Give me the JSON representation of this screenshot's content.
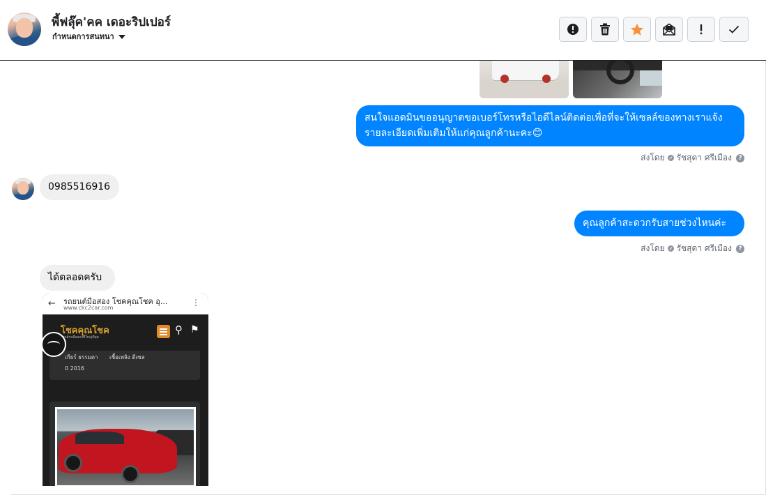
{
  "header": {
    "contact_name": "พี้ฟลุ๊ค'คค เดอะริปเปอร์",
    "conversation_settings": "กำหนดการสนทนา",
    "actions": [
      {
        "name": "mark-spam-button",
        "icon": "alert-circle-icon"
      },
      {
        "name": "delete-button",
        "icon": "trash-icon"
      },
      {
        "name": "star-button",
        "icon": "star-icon",
        "color": "#f7923a"
      },
      {
        "name": "mark-unread-button",
        "icon": "envelope-icon"
      },
      {
        "name": "follow-up-button",
        "icon": "exclamation-icon"
      },
      {
        "name": "mark-done-button",
        "icon": "check-icon"
      }
    ]
  },
  "messages": [
    {
      "direction": "outgoing",
      "text": "สนใจแอดมินขออนุญาตขอเบอร์โทรหรือไอดีไลน์ติดต่อเพื่อที่จะให้เซลล์ของทางเราแจ้งรายละเอียดเพิ่มเติมให้แก่คุณลูกค้านะคะ😊",
      "sent_by_label": "ส่งโดย",
      "sender": "รัชสุดา ศรีเมือง"
    },
    {
      "direction": "incoming",
      "text": "0985516916"
    },
    {
      "direction": "outgoing",
      "text": "คุณลูกค้าสะดวกรับสายช่วงไหนค่ะ",
      "sent_by_label": "ส่งโดย",
      "sender": "รัชสุดา ศรีเมือง"
    },
    {
      "direction": "incoming",
      "text": "ได้ตลอดครับ"
    }
  ],
  "screenshot": {
    "page_title": "รถยนต์มือสอง โชคคุณโชค อุ...",
    "url": "www.ckc2car.com",
    "brand": "โชคคุณโชค",
    "brand_tagline": "ศูนย์รถมือสองที่ใหญ่ที่สุด",
    "gear": "เกียร์ ธรรมดา",
    "fuel": "เชื้อเพลิง ดีเซล",
    "year": "0 2016"
  },
  "colors": {
    "outgoing_bubble": "#0084ff",
    "incoming_bubble": "#f1f0f0",
    "star": "#f7923a"
  }
}
